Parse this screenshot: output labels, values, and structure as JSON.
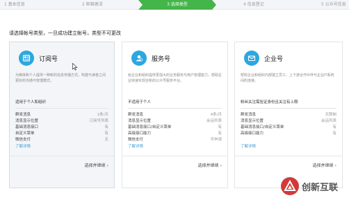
{
  "steps": [
    {
      "label": "1 基本信息"
    },
    {
      "label": "2 邮箱激活"
    },
    {
      "label": "3 选择类型"
    },
    {
      "label": "4 信息登记"
    },
    {
      "label": "5 公众号信息"
    }
  ],
  "active_step_color": "#44b549",
  "intro": "请选择帐号类型，一旦成功建立帐号，类型不可更改",
  "cards": [
    {
      "title": "订阅号",
      "icon": "news-icon",
      "desc": "为媒体和个人提供一种新的信息传播方式，构建与读者之间更好的沟通与管理模式。",
      "suit": "适用于个人和组织",
      "features": [
        {
          "k": "群发消息",
          "v": "1条/天"
        },
        {
          "k": "消息显示位置",
          "v": "订阅号列表"
        },
        {
          "k": "基础消息接口",
          "v": "有"
        },
        {
          "k": "自定义菜单",
          "v": "有"
        },
        {
          "k": "微信支付",
          "v": "无"
        }
      ],
      "more": "了解详情",
      "select": "选择并继续"
    },
    {
      "title": "服务号",
      "icon": "user-service-icon",
      "desc": "给企业和组织提供更强大的业务服务与用户管理能力，帮助企业快速实现全新的公众号服务平台。",
      "suit": "不适用于个人",
      "features": [
        {
          "k": "群发消息",
          "v": "4条/月"
        },
        {
          "k": "消息显示位置",
          "v": "会话列表"
        },
        {
          "k": "基础消息接口/自定义菜单",
          "v": "有"
        },
        {
          "k": "高级接口能力",
          "v": "有"
        },
        {
          "k": "微信支付",
          "v": "可申请"
        }
      ],
      "more": "了解详情",
      "select": "选择并继续"
    },
    {
      "title": "企业号",
      "icon": "mail-icon",
      "desc": "帮助企业和组织内部建立员工、上下游合作伙伴与企业IT系统间的连接。",
      "suit": "粉丝关注需验证身份且关注有上限",
      "features": [
        {
          "k": "群发消息",
          "v": "无限制"
        },
        {
          "k": "消息显示位置",
          "v": "会话列表"
        },
        {
          "k": "基础消息接口/自定义菜单",
          "v": "有"
        },
        {
          "k": "高级接口能力",
          "v": "有"
        }
      ],
      "more": "了解详情",
      "select": "选择并继续"
    }
  ],
  "watermark": "创新互联"
}
